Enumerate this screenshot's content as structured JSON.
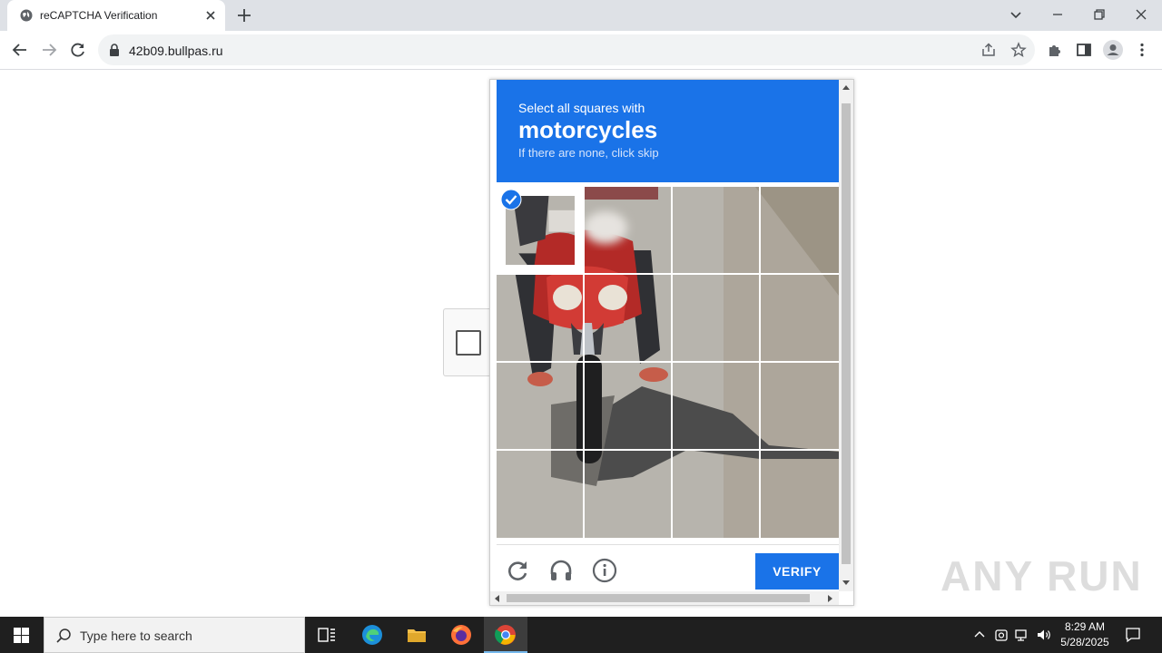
{
  "browser": {
    "tab_title": "reCAPTCHA Verification",
    "url": "42b09.bullpas.ru"
  },
  "captcha": {
    "instruction_line1": "Select all squares with",
    "target": "motorcycles",
    "instruction_line3": "If there are none, click skip",
    "verify_label": "VERIFY",
    "grid_rows": 4,
    "grid_cols": 4,
    "selected_tiles": [
      [
        0,
        0
      ]
    ],
    "header_color": "#1a73e8"
  },
  "watermark": "ANY RUN",
  "taskbar": {
    "search_placeholder": "Type here to search",
    "time": "8:29 AM",
    "date": "5/28/2025"
  }
}
